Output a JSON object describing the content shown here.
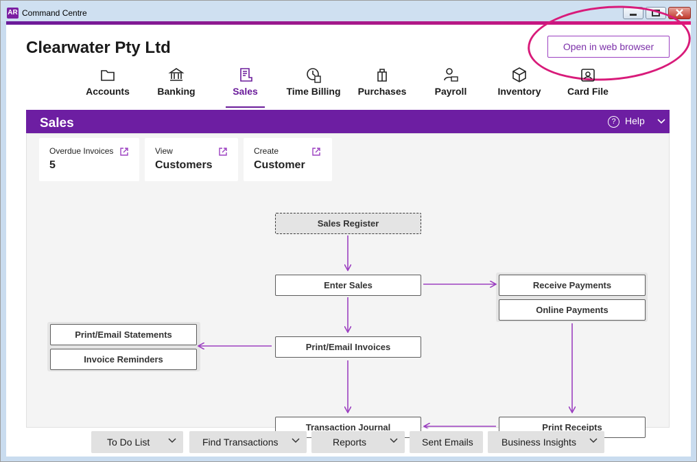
{
  "window": {
    "app_icon": "AR",
    "title": "Command Centre"
  },
  "header": {
    "company": "Clearwater Pty Ltd",
    "web_button": "Open in web browser"
  },
  "nav": [
    {
      "label": "Accounts",
      "icon": "folder-icon"
    },
    {
      "label": "Banking",
      "icon": "bank-icon"
    },
    {
      "label": "Sales",
      "icon": "receipt-icon",
      "active": true
    },
    {
      "label": "Time Billing",
      "icon": "clock-icon"
    },
    {
      "label": "Purchases",
      "icon": "shopping-bag-icon"
    },
    {
      "label": "Payroll",
      "icon": "person-cash-icon"
    },
    {
      "label": "Inventory",
      "icon": "box-icon"
    },
    {
      "label": "Card File",
      "icon": "contact-card-icon"
    }
  ],
  "panel": {
    "title": "Sales",
    "help": "Help"
  },
  "cards": [
    {
      "label": "Overdue Invoices",
      "value": "5"
    },
    {
      "label": "View",
      "value": "Customers"
    },
    {
      "label": "Create",
      "value": "Customer"
    }
  ],
  "flow": {
    "sales_register": "Sales Register",
    "enter_sales": "Enter Sales",
    "receive_payments": "Receive Payments",
    "online_payments": "Online Payments",
    "print_email_invoices": "Print/Email Invoices",
    "print_email_statements": "Print/Email Statements",
    "invoice_reminders": "Invoice Reminders",
    "transaction_journal": "Transaction Journal",
    "print_receipts": "Print Receipts"
  },
  "footer": [
    {
      "label": "To Do List",
      "dropdown": true
    },
    {
      "label": "Find Transactions",
      "dropdown": true
    },
    {
      "label": "Reports",
      "dropdown": true
    },
    {
      "label": "Sent Emails",
      "dropdown": false
    },
    {
      "label": "Business Insights",
      "dropdown": true
    }
  ],
  "colors": {
    "accent": "#6d1ea2",
    "highlight": "#d81b7a",
    "arrow": "#9b3fc0"
  }
}
